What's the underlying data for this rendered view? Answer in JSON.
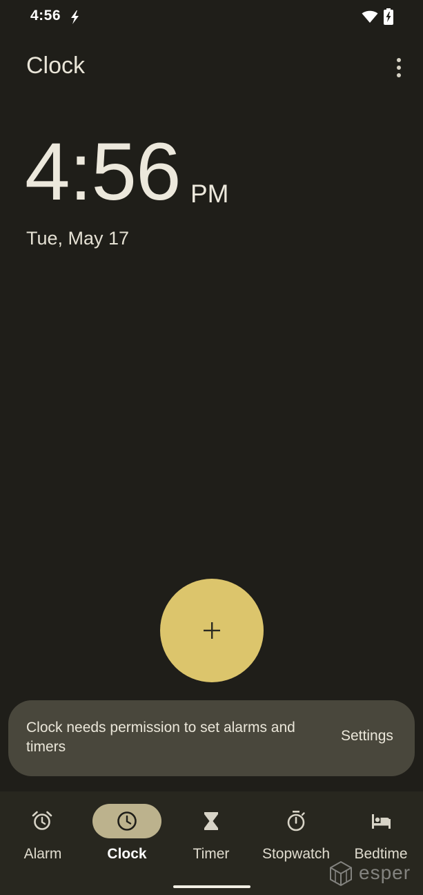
{
  "status_bar": {
    "time": "4:56",
    "icons": [
      "charging-bolt-icon",
      "wifi-icon",
      "battery-charging-icon"
    ]
  },
  "app_bar": {
    "title": "Clock",
    "menu_icon": "more-vert-icon"
  },
  "clock": {
    "time": "4:56",
    "ampm": "PM",
    "date": "Tue, May 17"
  },
  "fab": {
    "icon": "plus-icon",
    "color": "#dcc56c"
  },
  "snackbar": {
    "message": "Clock needs permission to set alarms and timers",
    "action": "Settings"
  },
  "bottom_nav": {
    "items": [
      {
        "label": "Alarm",
        "icon": "alarm-icon",
        "active": false
      },
      {
        "label": "Clock",
        "icon": "clock-icon",
        "active": true
      },
      {
        "label": "Timer",
        "icon": "hourglass-icon",
        "active": false
      },
      {
        "label": "Stopwatch",
        "icon": "stopwatch-icon",
        "active": false
      },
      {
        "label": "Bedtime",
        "icon": "bed-icon",
        "active": false
      }
    ],
    "active_pill_color": "#bcb28d"
  },
  "watermark": {
    "text": "esper"
  },
  "colors": {
    "background": "#1f1e19",
    "nav_background": "#28271f",
    "snackbar_background": "#49473c",
    "accent": "#dcc56c"
  }
}
